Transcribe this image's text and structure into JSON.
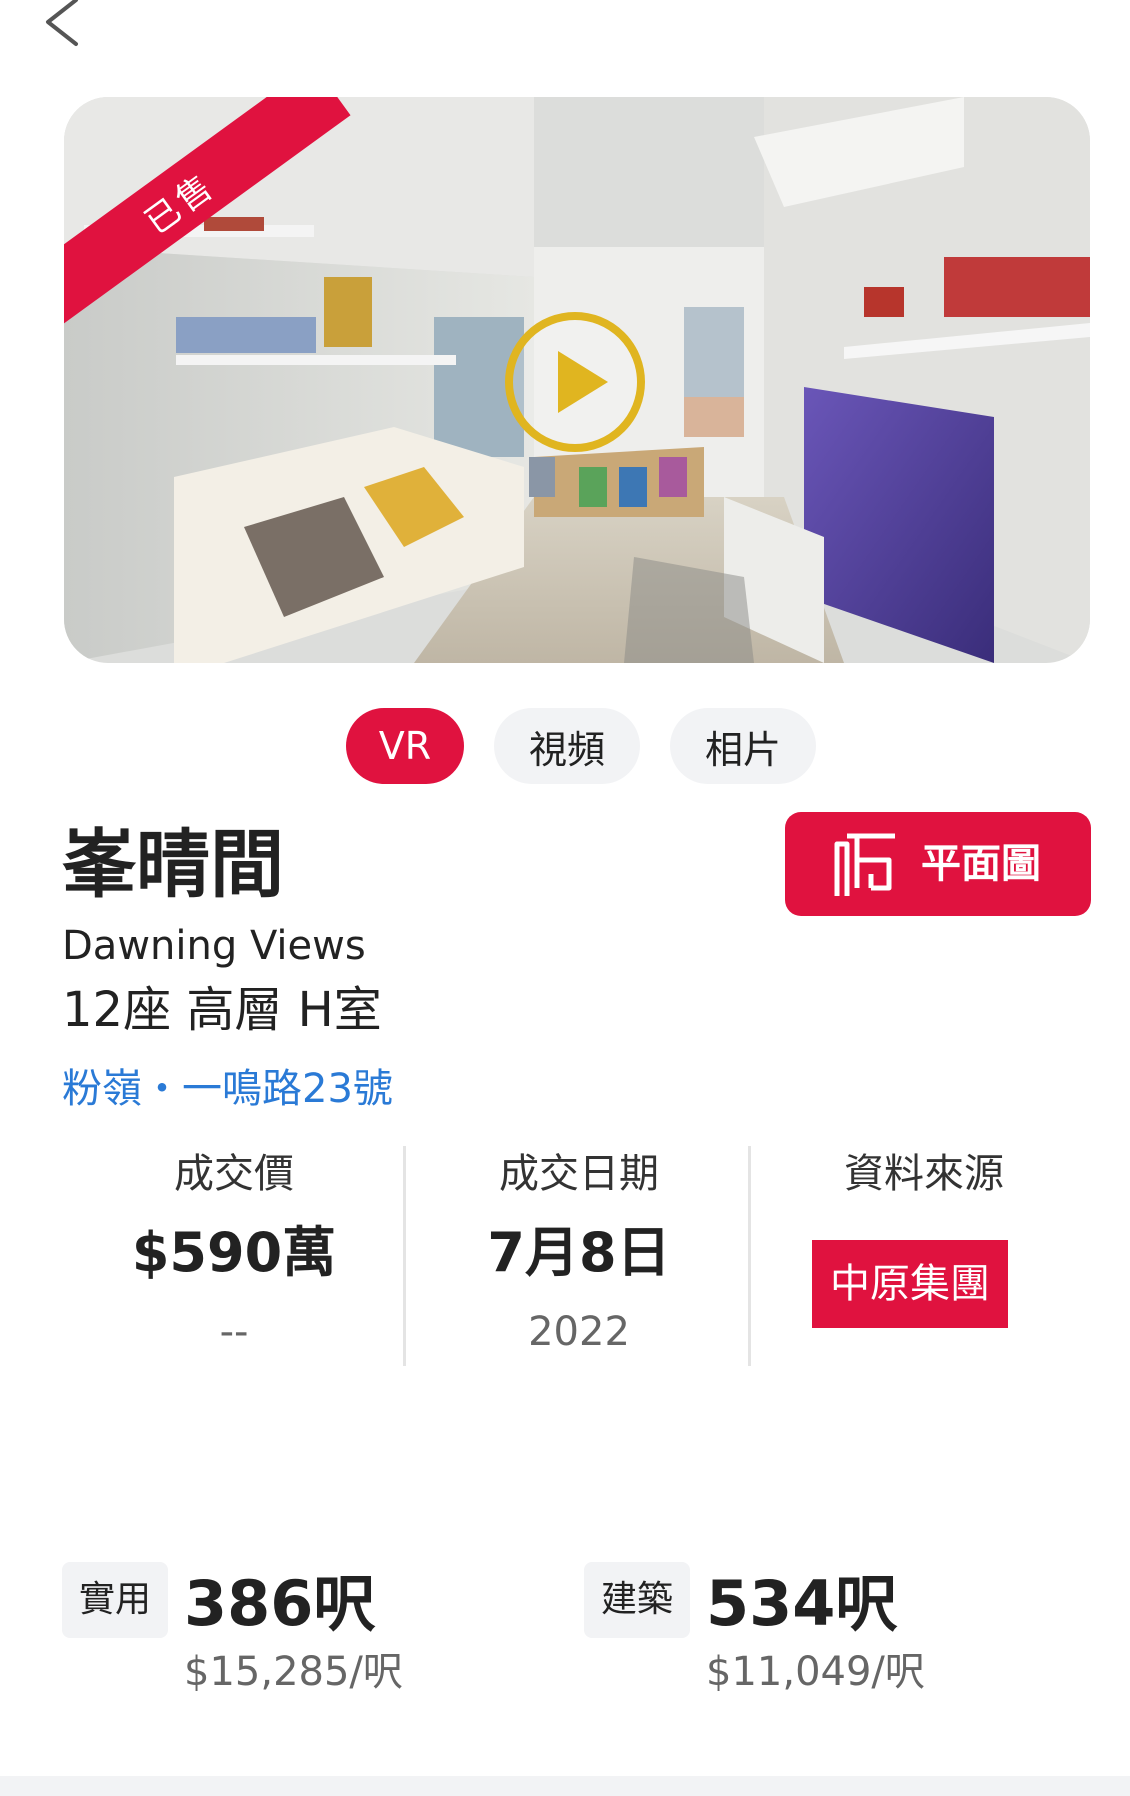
{
  "nav": {
    "back_icon": "chevron-left-icon"
  },
  "hero": {
    "sold_label": "已售",
    "play_icon": "play-icon",
    "colors": {
      "ribbon": "#e0123f",
      "play_ring": "#e0b520"
    }
  },
  "media_tabs": [
    {
      "label": "VR",
      "active": true
    },
    {
      "label": "視頻",
      "active": false
    },
    {
      "label": "相片",
      "active": false
    }
  ],
  "property": {
    "name_zh": "峯晴間",
    "name_en": "Dawning Views",
    "unit": "12座 高層 H室",
    "address": "粉嶺・一鳴路23號"
  },
  "floorplan_button": {
    "label": "平面圖",
    "icon": "floorplan-icon"
  },
  "stats": {
    "price": {
      "label": "成交價",
      "value": "$590萬",
      "sub": "--"
    },
    "date": {
      "label": "成交日期",
      "value": "7月8日",
      "sub": "2022"
    },
    "source": {
      "label": "資料來源",
      "value": "中原集團"
    }
  },
  "areas": {
    "saleable": {
      "tag": "實用",
      "value": "386呎",
      "price": "$15,285/呎"
    },
    "gross": {
      "tag": "建築",
      "value": "534呎",
      "price": "$11,049/呎"
    }
  },
  "theme": {
    "accent": "#e0123f",
    "link": "#2a7ad6"
  }
}
